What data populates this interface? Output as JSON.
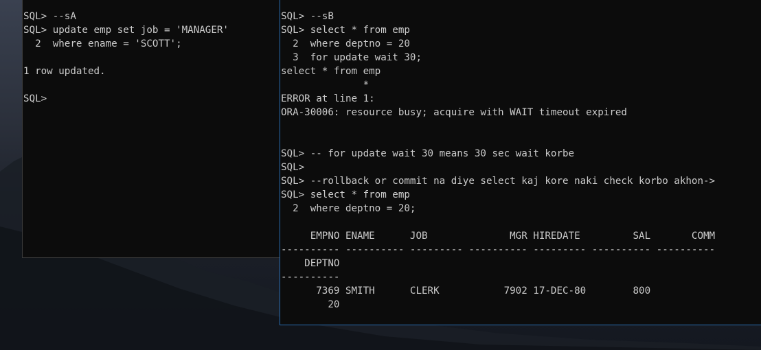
{
  "console_a": {
    "lines": [
      "SQL> --sA",
      "SQL> update emp set job = 'MANAGER'",
      "  2  where ename = 'SCOTT';",
      "",
      "1 row updated.",
      "",
      "SQL>"
    ]
  },
  "console_b": {
    "lines": [
      "SQL> --sB",
      "SQL> select * from emp",
      "  2  where deptno = 20",
      "  3  for update wait 30;",
      "select * from emp",
      "              *",
      "ERROR at line 1:",
      "ORA-30006: resource busy; acquire with WAIT timeout expired",
      "",
      "",
      "SQL> -- for update wait 30 means 30 sec wait korbe",
      "SQL>",
      "SQL> --rollback or commit na diye select kaj kore naki check korbo akhon->",
      "SQL> select * from emp",
      "  2  where deptno = 20;",
      "",
      "     EMPNO ENAME      JOB              MGR HIREDATE         SAL       COMM",
      "---------- ---------- --------- ---------- --------- ---------- ----------",
      "    DEPTNO",
      "----------",
      "      7369 SMITH      CLERK           7902 17-DEC-80        800",
      "        20"
    ]
  }
}
